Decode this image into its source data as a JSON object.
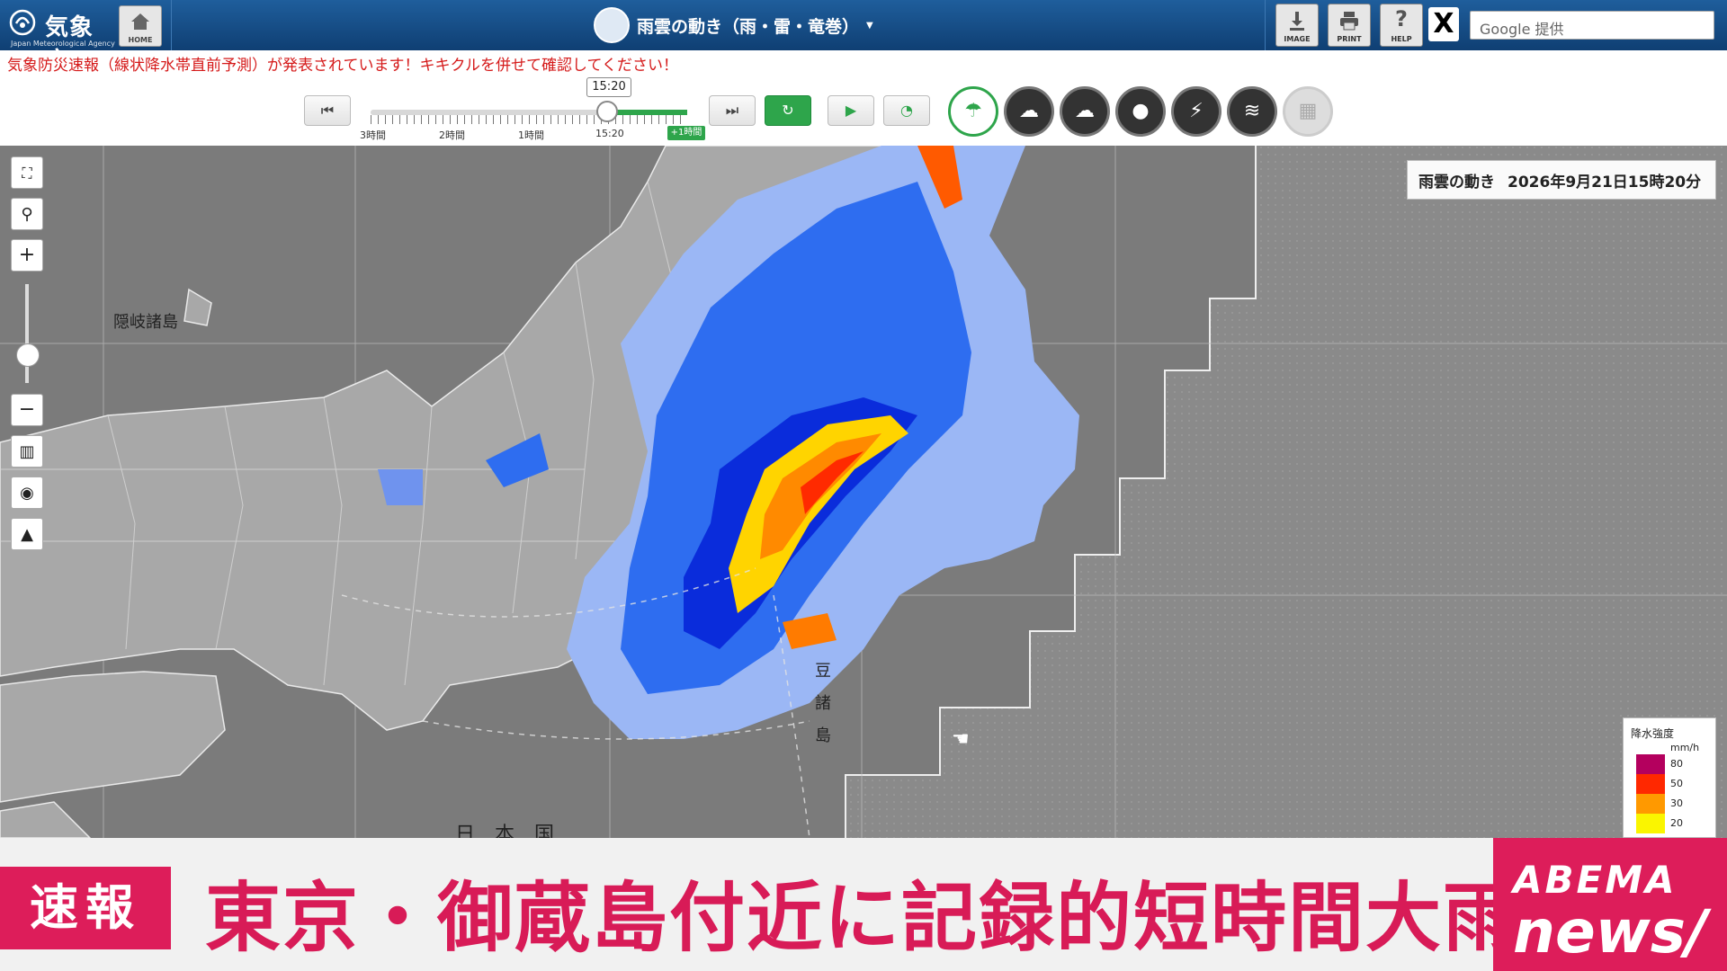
{
  "header": {
    "brand_name": "気象庁",
    "brand_sub": "Japan Meteorological Agency",
    "home_label": "HOME",
    "page_title": "雨雲の動き（雨・雷・竜巻）",
    "image_label": "IMAGE",
    "print_label": "PRINT",
    "help_label": "HELP",
    "x_label": "X",
    "search_placeholder": "Google 提供"
  },
  "warning": {
    "text": "気象防災速報（線状降水帯直前予測）が発表されています！キキクルを併せて確認してください！"
  },
  "timeline": {
    "current_time": "15:20",
    "labels": [
      "3時間",
      "2時間",
      "1時間",
      "15:20"
    ],
    "forecast_label": "+1時間",
    "position_fraction": 0.75,
    "icons": {
      "first": "skip-back-icon",
      "last": "skip-forward-icon",
      "refresh": "refresh-icon",
      "play": "play-icon",
      "speed": "speedometer-icon"
    }
  },
  "layers": [
    {
      "name": "rain-cloud-layer",
      "state": "active"
    },
    {
      "name": "thunder-cloud-layer",
      "state": "normal"
    },
    {
      "name": "tornado-cloud-layer",
      "state": "normal"
    },
    {
      "name": "rain-drop-layer",
      "state": "normal"
    },
    {
      "name": "lightning-layer",
      "state": "normal"
    },
    {
      "name": "wind-layer",
      "state": "normal"
    },
    {
      "name": "disabled-layer",
      "state": "disabled"
    }
  ],
  "map": {
    "info_title": "雨雲の動き",
    "info_datetime": "2026年9月21日15時20分",
    "labels": {
      "oki": "隠岐諸島",
      "izu": "豆",
      "islands": "諸",
      "island": "島",
      "japan": "日　本　国"
    }
  },
  "legend": {
    "title": "降水強度",
    "unit": "mm/h",
    "levels": [
      {
        "value": "80",
        "color": "#b4005e"
      },
      {
        "value": "50",
        "color": "#ff2800"
      },
      {
        "value": "30",
        "color": "#ff9900"
      },
      {
        "value": "20",
        "color": "#faf500"
      }
    ]
  },
  "banner": {
    "breaking_label": "速報",
    "headline": "東京・御蔵島付近に記録的短時間大雨",
    "abema_top": "ABEMA",
    "abema_bottom": "news/"
  },
  "colors": {
    "header_bg": "#15497f",
    "accent_green": "#2ea54b",
    "warning_red": "#d51a1a",
    "banner_pink": "#dd1d5a"
  }
}
